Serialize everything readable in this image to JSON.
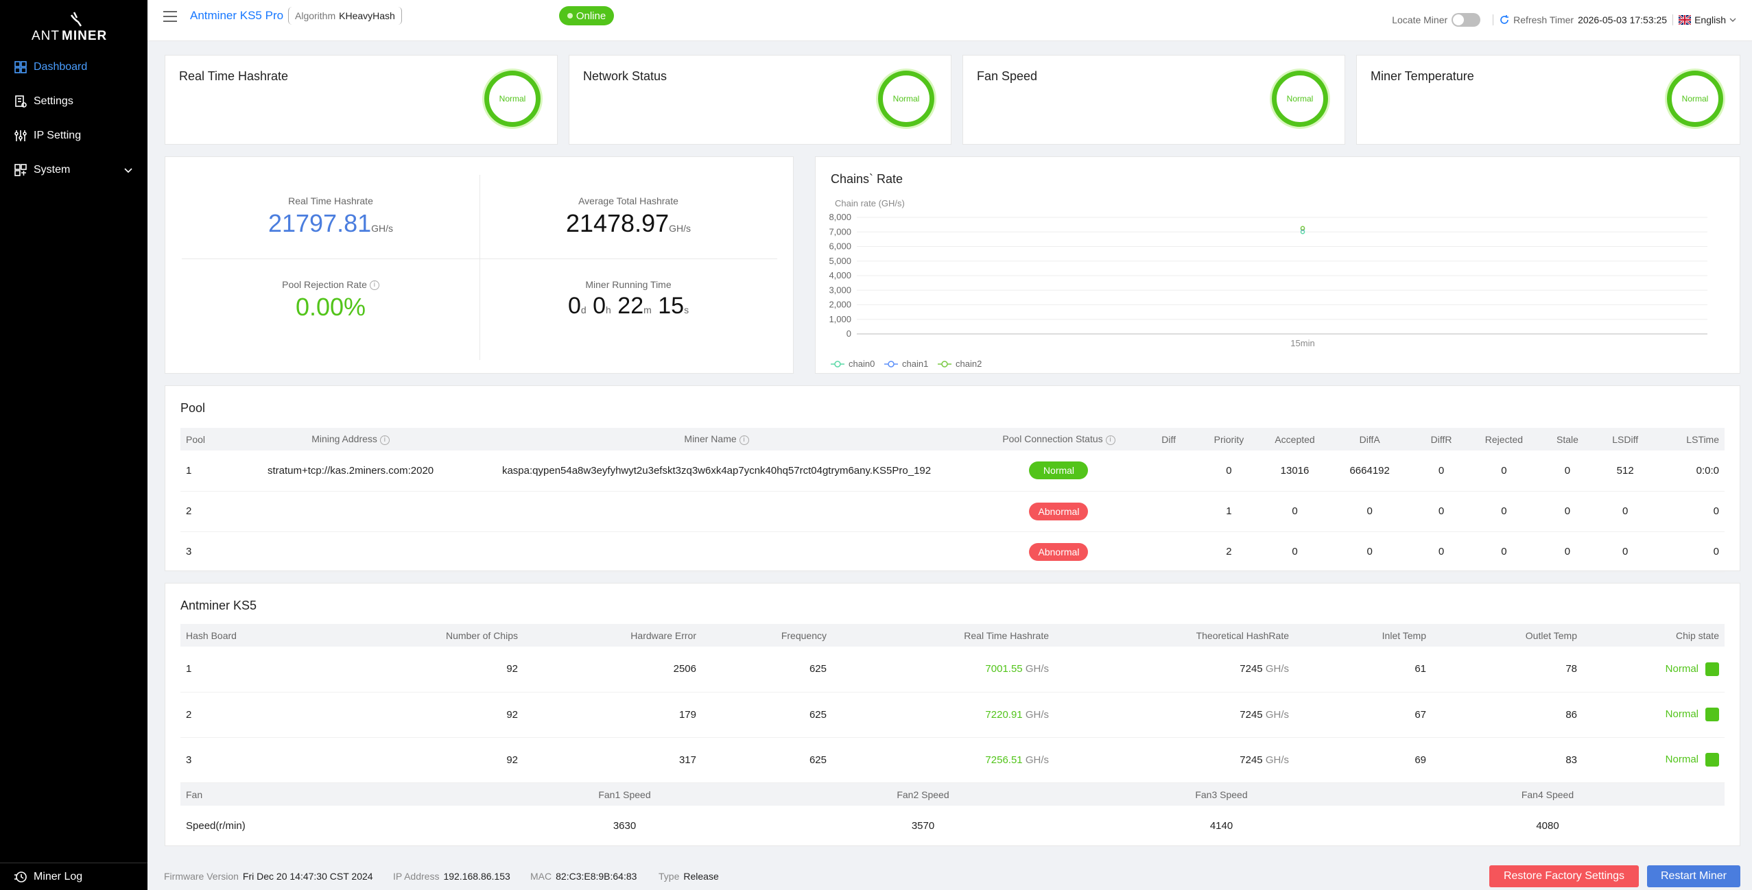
{
  "brand": {
    "logo_text_ant": "ANT",
    "logo_text_miner": "MINER"
  },
  "sidebar": {
    "items": [
      {
        "label": "Dashboard",
        "icon": "dashboard-icon",
        "active": true
      },
      {
        "label": "Settings",
        "icon": "settings-icon"
      },
      {
        "label": "IP Setting",
        "icon": "network-icon"
      },
      {
        "label": "System",
        "icon": "system-icon"
      }
    ],
    "bottom_label": "Miner Log"
  },
  "header": {
    "model": "Antminer KS5 Pro",
    "algorithm_label": "Algorithm",
    "algorithm_value": "KHeavyHash",
    "status": "Online",
    "locate_label": "Locate Miner",
    "refresh_label": "Refresh Timer",
    "refresh_time": "2026-05-03 17:53:25",
    "language": "English"
  },
  "status_cards": [
    {
      "title": "Real Time Hashrate",
      "state": "Normal"
    },
    {
      "title": "Network Status",
      "state": "Normal"
    },
    {
      "title": "Fan Speed",
      "state": "Normal"
    },
    {
      "title": "Miner Temperature",
      "state": "Normal"
    }
  ],
  "stats": {
    "rt_label": "Real Time Hashrate",
    "rt_value": "21797.81",
    "rt_unit": "GH/s",
    "avg_label": "Average Total Hashrate",
    "avg_value": "21478.97",
    "avg_unit": "GH/s",
    "rej_label": "Pool Rejection Rate",
    "rej_value": "0.00%",
    "run_label": "Miner Running Time",
    "run_d": "0",
    "run_d_u": "d",
    "run_h": "0",
    "run_h_u": "h",
    "run_m": "22",
    "run_m_u": "m",
    "run_s": "15",
    "run_s_u": "s"
  },
  "chart_title": "Chains` Rate",
  "chart_data": {
    "type": "line",
    "ylabel": "Chain rate (GH/s)",
    "ylim": [
      0,
      8000
    ],
    "yticks": [
      "8,000",
      "7,000",
      "6,000",
      "5,000",
      "4,000",
      "3,000",
      "2,000",
      "1,000",
      "0"
    ],
    "categories": [
      "15min"
    ],
    "series": [
      {
        "name": "chain0",
        "values": [
          7001.55
        ],
        "color": "#5ad8a6"
      },
      {
        "name": "chain1",
        "values": [
          7220.91
        ],
        "color": "#5b8ff9"
      },
      {
        "name": "chain2",
        "values": [
          7256.51
        ],
        "color": "#7ac943"
      }
    ],
    "legend": "bottom-left",
    "grid": true
  },
  "pool": {
    "title": "Pool",
    "headers": [
      "Pool",
      "Mining Address",
      "Miner Name",
      "Pool Connection Status",
      "Diff",
      "Priority",
      "Accepted",
      "DiffA",
      "DiffR",
      "Rejected",
      "Stale",
      "LSDiff",
      "LSTime"
    ],
    "rows": [
      {
        "pool": "1",
        "address": "stratum+tcp://kas.2miners.com:2020",
        "name": "kaspa:qypen54a8w3eyfyhwyt2u3efskt3zq3w6xk4ap7ycnk40hq57rct04gtrym6any.KS5Pro_192",
        "status": "Normal",
        "ok": true,
        "diff": "",
        "priority": "0",
        "accepted": "13016",
        "diffa": "6664192",
        "diffr": "0",
        "rejected": "0",
        "stale": "0",
        "lsdiff": "512",
        "lstime": "0:0:0"
      },
      {
        "pool": "2",
        "address": "",
        "name": "",
        "status": "Abnormal",
        "ok": false,
        "diff": "",
        "priority": "1",
        "accepted": "0",
        "diffa": "0",
        "diffr": "0",
        "rejected": "0",
        "stale": "0",
        "lsdiff": "0",
        "lstime": "0"
      },
      {
        "pool": "3",
        "address": "",
        "name": "",
        "status": "Abnormal",
        "ok": false,
        "diff": "",
        "priority": "2",
        "accepted": "0",
        "diffa": "0",
        "diffr": "0",
        "rejected": "0",
        "stale": "0",
        "lsdiff": "0",
        "lstime": "0"
      }
    ]
  },
  "boards": {
    "title": "Antminer KS5",
    "headers": [
      "Hash Board",
      "Number of Chips",
      "Hardware Error",
      "Frequency",
      "Real Time Hashrate",
      "Theoretical HashRate",
      "Inlet Temp",
      "Outlet Temp",
      "Chip state"
    ],
    "unit": "GH/s",
    "rows": [
      {
        "board": "1",
        "chips": "92",
        "hwerr": "2506",
        "freq": "625",
        "rt": "7001.55",
        "theo": "7245",
        "inlet": "61",
        "outlet": "78",
        "state": "Normal"
      },
      {
        "board": "2",
        "chips": "92",
        "hwerr": "179",
        "freq": "625",
        "rt": "7220.91",
        "theo": "7245",
        "inlet": "67",
        "outlet": "86",
        "state": "Normal"
      },
      {
        "board": "3",
        "chips": "92",
        "hwerr": "317",
        "freq": "625",
        "rt": "7256.51",
        "theo": "7245",
        "inlet": "69",
        "outlet": "83",
        "state": "Normal"
      }
    ],
    "fan_headers": [
      "Fan",
      "Fan1 Speed",
      "Fan2 Speed",
      "Fan3 Speed",
      "Fan4 Speed"
    ],
    "fan_row": [
      "Speed(r/min)",
      "3630",
      "3570",
      "4140",
      "4080"
    ]
  },
  "footer": {
    "fw_label": "Firmware Version",
    "fw_value": "Fri Dec 20 14:47:30 CST 2024",
    "ip_label": "IP Address",
    "ip_value": "192.168.86.153",
    "mac_label": "MAC",
    "mac_value": "82:C3:E8:9B:64:83",
    "type_label": "Type",
    "type_value": "Release",
    "restore_label": "Restore Factory Settings",
    "restart_label": "Restart Miner"
  }
}
